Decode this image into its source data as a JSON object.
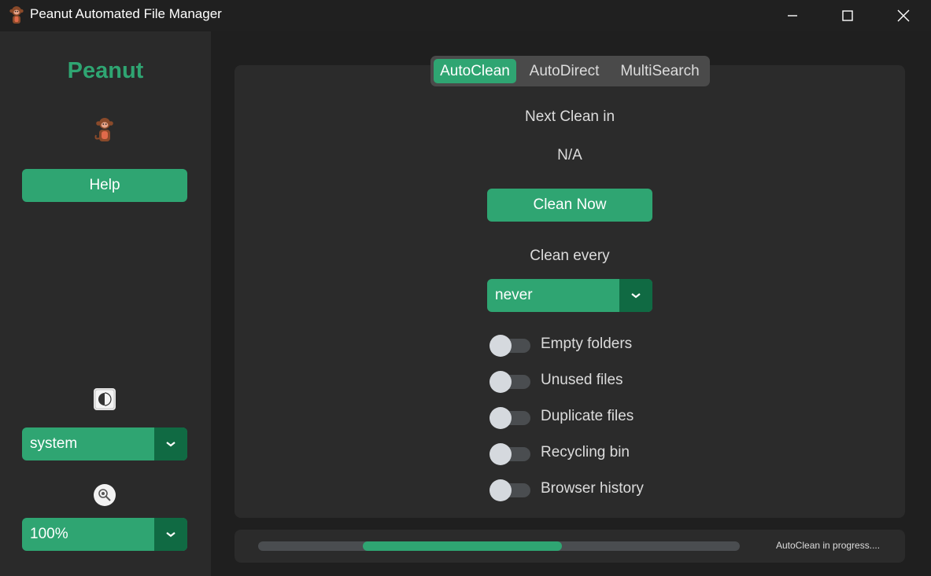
{
  "window": {
    "title": "Peanut Automated File Manager",
    "app_icon": "monkey-icon"
  },
  "sidebar": {
    "brand": "Peanut",
    "help_label": "Help",
    "appearance_icon": "theme-toggle-icon",
    "appearance_mode": "system",
    "scaling_icon": "zoom-icon",
    "scaling": "100%"
  },
  "tabs": [
    {
      "label": "AutoClean",
      "active": true
    },
    {
      "label": "AutoDirect",
      "active": false
    },
    {
      "label": "MultiSearch",
      "active": false
    }
  ],
  "autoclean": {
    "next_clean_label": "Next Clean in",
    "next_clean_value": "N/A",
    "clean_now_label": "Clean Now",
    "clean_every_label": "Clean every",
    "clean_every_value": "never",
    "options": [
      {
        "label": "Empty folders",
        "on": false
      },
      {
        "label": "Unused files",
        "on": false
      },
      {
        "label": "Duplicate files",
        "on": false
      },
      {
        "label": "Recycling bin",
        "on": false
      },
      {
        "label": "Browser history",
        "on": false
      }
    ]
  },
  "status": {
    "text": "AutoClean in progress....",
    "progress_start": 0.217,
    "progress_end": 0.631
  },
  "colors": {
    "accent": "#2fa572",
    "accent_dark": "#106a43",
    "background": "#1f1f1f",
    "panel": "#2b2b2b"
  }
}
